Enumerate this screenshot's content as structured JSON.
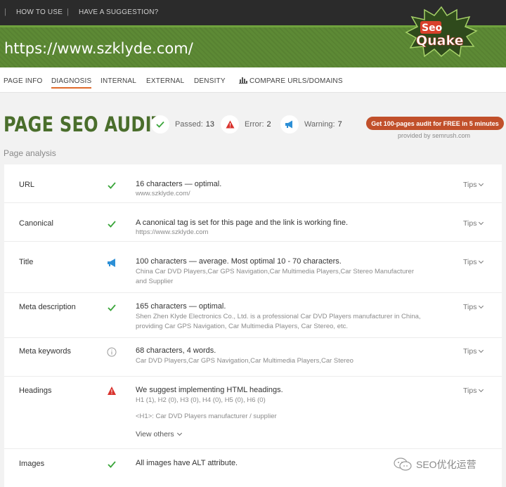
{
  "topbar": {
    "links": [
      {
        "label": "HOW TO USE"
      },
      {
        "label": "HAVE A SUGGESTION?"
      }
    ]
  },
  "header": {
    "url": "https://www.szklyde.com/",
    "logo_text": "SeoQuake"
  },
  "nav": {
    "tabs": [
      {
        "label": "PAGE INFO"
      },
      {
        "label": "DIAGNOSIS",
        "active": true
      },
      {
        "label": "INTERNAL"
      },
      {
        "label": "EXTERNAL"
      },
      {
        "label": "DENSITY"
      },
      {
        "label": "COMPARE URLS/DOMAINS"
      }
    ]
  },
  "audit": {
    "title": "PAGE SEO AUDIT",
    "passed_label": "Passed:",
    "passed_count": "13",
    "error_label": "Error:",
    "error_count": "2",
    "warning_label": "Warning:",
    "warning_count": "7",
    "cta_label": "Get 100-pages audit for FREE in 5 minutes",
    "provided_by": "provided by  semrush.com",
    "section_title": "Page analysis"
  },
  "colors": {
    "pass": "#3aa53a",
    "error": "#d9332e",
    "warning": "#2c8fd6",
    "accent": "#c1502b"
  },
  "rows": [
    {
      "name": "URL",
      "status": "check-icon",
      "desc": "16 characters — optimal.",
      "sub": "www.szklyde.com/",
      "tips": "Tips"
    },
    {
      "name": "Canonical",
      "status": "check-icon",
      "desc": "A canonical tag is set for this page and the link is working fine.",
      "sub": "https://www.szklyde.com",
      "tips": "Tips"
    },
    {
      "name": "Title",
      "status": "megaphone-icon",
      "desc": "100 characters — average. Most optimal 10 - 70 characters.",
      "sub": "China Car DVD Players,Car GPS Navigation,Car Multimedia Players,Car Stereo Manufacturer and Supplier",
      "tips": "Tips"
    },
    {
      "name": "Meta description",
      "status": "check-icon",
      "desc": "165 characters — optimal.",
      "sub": "Shen Zhen Klyde Electronics Co., Ltd. is a professional Car DVD Players manufacturer in China, providing Car GPS Navigation, Car Multimedia Players, Car Stereo, etc.",
      "tips": "Tips"
    },
    {
      "name": "Meta keywords",
      "status": "info-icon",
      "desc": "68 characters, 4 words.",
      "sub": "Car DVD Players,Car GPS Navigation,Car Multimedia Players,Car Stereo",
      "tips": "Tips"
    },
    {
      "name": "Headings",
      "status": "error-triangle-icon",
      "desc": "We suggest implementing HTML headings.",
      "sub": "H1 (1), H2 (0), H3 (0), H4 (0), H5 (0), H6 (0)",
      "sub2": "<H1>: Car DVD Players manufacturer / supplier",
      "view_others": "View others",
      "tips": "Tips"
    },
    {
      "name": "Images",
      "status": "check-icon",
      "desc": "All images have ALT attribute.",
      "sub": "",
      "tips": ""
    }
  ],
  "watermark": {
    "text": "SEO优化运营"
  }
}
